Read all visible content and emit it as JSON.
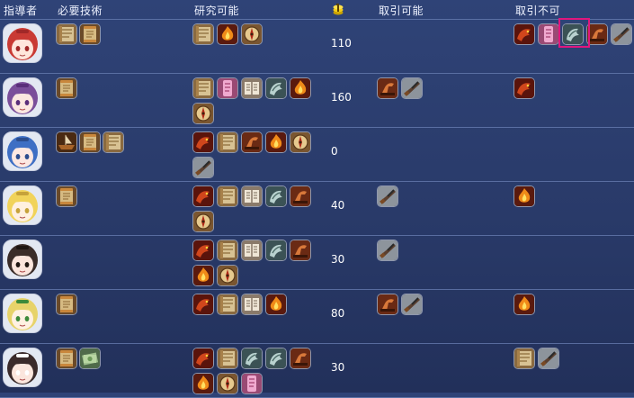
{
  "headers": {
    "leader": "指導者",
    "required_tech": "必要技術",
    "researchable": "研究可能",
    "tradeable": "取引可能",
    "not_tradeable": "取引不可"
  },
  "colors": {
    "background": "#2a3c6d",
    "separator": "#6a7fb3",
    "highlight": "#e0177d"
  },
  "rows": [
    {
      "leader": "red-haired-girl-portrait",
      "required": [
        "map-scroll-icon",
        "scroll-icon"
      ],
      "research": [
        "map-scroll-icon",
        "fire-icon",
        "compass-icon"
      ],
      "cost": "110",
      "tradeable": [],
      "not_tradeable": [
        "dragon-icon",
        "pink-scroll-icon",
        "metal-dragon-icon",
        "horse-icon",
        "musket-icon"
      ]
    },
    {
      "leader": "purple-haired-girl-portrait",
      "required": [
        "scroll-icon"
      ],
      "research": [
        "map-scroll-icon",
        "pink-scroll-icon",
        "book-icon",
        "metal-dragon-icon",
        "fire-icon",
        "compass-icon"
      ],
      "cost": "160",
      "tradeable": [
        "horse-icon",
        "musket-icon"
      ],
      "not_tradeable": [
        "dragon-icon"
      ]
    },
    {
      "leader": "blue-haired-girl-portrait",
      "required": [
        "ship-icon",
        "scroll-icon",
        "map-scroll-icon"
      ],
      "research": [
        "dragon-icon",
        "map-scroll-icon",
        "horse-icon",
        "fire-icon",
        "compass-icon",
        "musket-icon"
      ],
      "cost": "0",
      "tradeable": [],
      "not_tradeable": []
    },
    {
      "leader": "blonde-girl-portrait",
      "required": [
        "scroll-icon"
      ],
      "research": [
        "dragon-icon",
        "map-scroll-icon",
        "book-icon",
        "metal-dragon-icon",
        "horse-icon",
        "compass-icon"
      ],
      "cost": "40",
      "tradeable": [
        "musket-icon"
      ],
      "not_tradeable": [
        "fire-icon"
      ]
    },
    {
      "leader": "dark-haired-girl-portrait",
      "required": [],
      "research": [
        "dragon-icon",
        "map-scroll-icon",
        "book-icon",
        "metal-dragon-icon",
        "horse-icon",
        "fire-icon",
        "compass-icon"
      ],
      "cost": "30",
      "tradeable": [
        "musket-icon"
      ],
      "not_tradeable": []
    },
    {
      "leader": "green-ribbon-girl-portrait",
      "required": [
        "scroll-icon"
      ],
      "research": [
        "dragon-icon",
        "map-scroll-icon",
        "book-icon",
        "fire-icon"
      ],
      "cost": "80",
      "tradeable": [
        "horse-icon",
        "musket-icon"
      ],
      "not_tradeable": [
        "fire-icon"
      ]
    },
    {
      "leader": "bunny-girl-portrait",
      "required": [
        "scroll-icon",
        "money-icon"
      ],
      "research": [
        "dragon-icon",
        "map-scroll-icon",
        "metal-dragon-icon",
        "metal-dragon-icon",
        "horse-icon",
        "fire-icon",
        "compass-icon",
        "pink-scroll-icon"
      ],
      "cost": "30",
      "tradeable": [],
      "not_tradeable": [
        "map-scroll-icon",
        "musket-icon"
      ]
    }
  ]
}
